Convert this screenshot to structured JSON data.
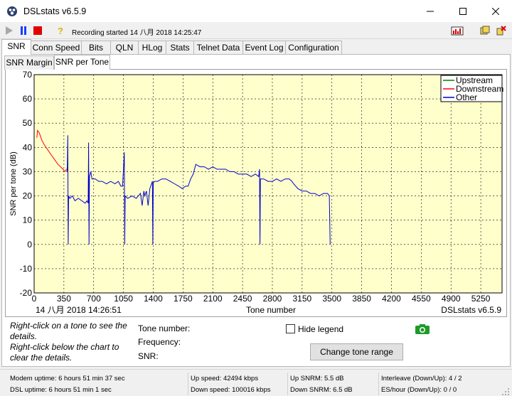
{
  "window": {
    "title": "DSLstats v6.5.9"
  },
  "toolbar": {
    "recording": "Recording started 14 八月 2018 14:25:47"
  },
  "tabs": [
    "SNR",
    "Conn Speed",
    "Bits",
    "QLN",
    "HLog",
    "Stats",
    "Telnet Data",
    "Event Log",
    "Configuration"
  ],
  "subtabs": [
    "SNR Margin",
    "SNR per Tone"
  ],
  "chart": {
    "timestamp": "14 八月 2018 14:26:51",
    "watermark": "DSLstats v6.5.9"
  },
  "colors": {
    "upstream": "#008000",
    "downstream": "#ff0000",
    "other": "#0000cc",
    "plot_bg": "#ffffcc"
  },
  "chart_data": {
    "type": "line",
    "xlabel": "Tone number",
    "ylabel": "SNR per tone (dB)",
    "xlim": [
      0,
      5500
    ],
    "ylim": [
      -20,
      70
    ],
    "xticks": [
      0,
      350,
      700,
      1050,
      1400,
      1750,
      2100,
      2450,
      2800,
      3150,
      3500,
      3850,
      4200,
      4550,
      4900,
      5250
    ],
    "yticks": [
      -20,
      -10,
      0,
      10,
      20,
      30,
      40,
      50,
      60,
      70
    ],
    "grid": true,
    "legend_position": "top-right",
    "series": [
      {
        "name": "Upstream",
        "color": "#008000",
        "points": []
      },
      {
        "name": "Downstream",
        "color": "#ff0000",
        "points": [
          [
            32,
            44
          ],
          [
            40,
            47
          ],
          [
            60,
            46
          ],
          [
            90,
            43
          ],
          [
            120,
            41
          ],
          [
            160,
            39
          ],
          [
            200,
            37
          ],
          [
            240,
            35
          ],
          [
            280,
            33
          ],
          [
            310,
            32
          ],
          [
            340,
            31
          ],
          [
            360,
            30
          ],
          [
            380,
            31
          ]
        ]
      },
      {
        "name": "Other",
        "color": "#0000cc",
        "points": [
          [
            385,
            30
          ],
          [
            390,
            32
          ],
          [
            395,
            45
          ],
          [
            400,
            0
          ],
          [
            405,
            20
          ],
          [
            420,
            19
          ],
          [
            450,
            20
          ],
          [
            480,
            18
          ],
          [
            520,
            19
          ],
          [
            560,
            18
          ],
          [
            600,
            17
          ],
          [
            620,
            18
          ],
          [
            635,
            17
          ],
          [
            640,
            42
          ],
          [
            645,
            0
          ],
          [
            650,
            28
          ],
          [
            665,
            30
          ],
          [
            680,
            27
          ],
          [
            720,
            27
          ],
          [
            760,
            26
          ],
          [
            800,
            26
          ],
          [
            850,
            25
          ],
          [
            900,
            26
          ],
          [
            950,
            25
          ],
          [
            990,
            26
          ],
          [
            1020,
            24
          ],
          [
            1040,
            24
          ],
          [
            1060,
            38
          ],
          [
            1065,
            0
          ],
          [
            1070,
            20
          ],
          [
            1100,
            19
          ],
          [
            1150,
            20
          ],
          [
            1200,
            19
          ],
          [
            1250,
            21
          ],
          [
            1270,
            16
          ],
          [
            1290,
            22
          ],
          [
            1300,
            20
          ],
          [
            1320,
            22
          ],
          [
            1340,
            16
          ],
          [
            1360,
            23
          ],
          [
            1380,
            25
          ],
          [
            1390,
            26
          ],
          [
            1395,
            0
          ],
          [
            1400,
            25
          ],
          [
            1410,
            26
          ],
          [
            1450,
            26
          ],
          [
            1500,
            27
          ],
          [
            1550,
            27
          ],
          [
            1600,
            26
          ],
          [
            1650,
            25
          ],
          [
            1700,
            24
          ],
          [
            1740,
            23
          ],
          [
            1780,
            24
          ],
          [
            1810,
            24
          ],
          [
            1840,
            27
          ],
          [
            1870,
            29
          ],
          [
            1900,
            33
          ],
          [
            1950,
            32
          ],
          [
            2000,
            32
          ],
          [
            2050,
            31
          ],
          [
            2100,
            32
          ],
          [
            2150,
            31
          ],
          [
            2200,
            31
          ],
          [
            2250,
            31
          ],
          [
            2300,
            30
          ],
          [
            2350,
            30
          ],
          [
            2400,
            29
          ],
          [
            2450,
            29
          ],
          [
            2500,
            29
          ],
          [
            2550,
            28
          ],
          [
            2600,
            29
          ],
          [
            2640,
            28
          ],
          [
            2650,
            31
          ],
          [
            2655,
            0
          ],
          [
            2660,
            27
          ],
          [
            2700,
            27
          ],
          [
            2750,
            26
          ],
          [
            2800,
            26
          ],
          [
            2850,
            27
          ],
          [
            2900,
            26
          ],
          [
            2950,
            27
          ],
          [
            3000,
            27
          ],
          [
            3030,
            26
          ],
          [
            3050,
            25
          ],
          [
            3100,
            23
          ],
          [
            3150,
            22
          ],
          [
            3200,
            22
          ],
          [
            3250,
            21
          ],
          [
            3300,
            21
          ],
          [
            3350,
            20
          ],
          [
            3400,
            21
          ],
          [
            3450,
            21
          ],
          [
            3470,
            20
          ],
          [
            3480,
            0
          ]
        ]
      }
    ]
  },
  "details": {
    "hint1": "Right-click on a tone to see the details.",
    "hint2": "Right-click below the chart to clear the details.",
    "tone_number_label": "Tone number:",
    "frequency_label": "Frequency:",
    "snr_label": "SNR:",
    "hide_legend_label": "Hide legend",
    "change_tone_range_label": "Change tone range"
  },
  "status": {
    "modem_uptime": "Modem uptime:  6 hours 51 min 37 sec",
    "dsl_uptime": "DSL uptime:  6 hours 51 min 1 sec",
    "up_speed": "Up speed: 42494 kbps",
    "down_speed": "Down speed: 100016 kbps",
    "up_snrm": "Up SNRM: 5.5 dB",
    "down_snrm": "Down SNRM: 6.5 dB",
    "interleave": "Interleave (Down/Up): 4 / 2",
    "es_hour": "ES/hour (Down/Up): 0 / 0"
  }
}
